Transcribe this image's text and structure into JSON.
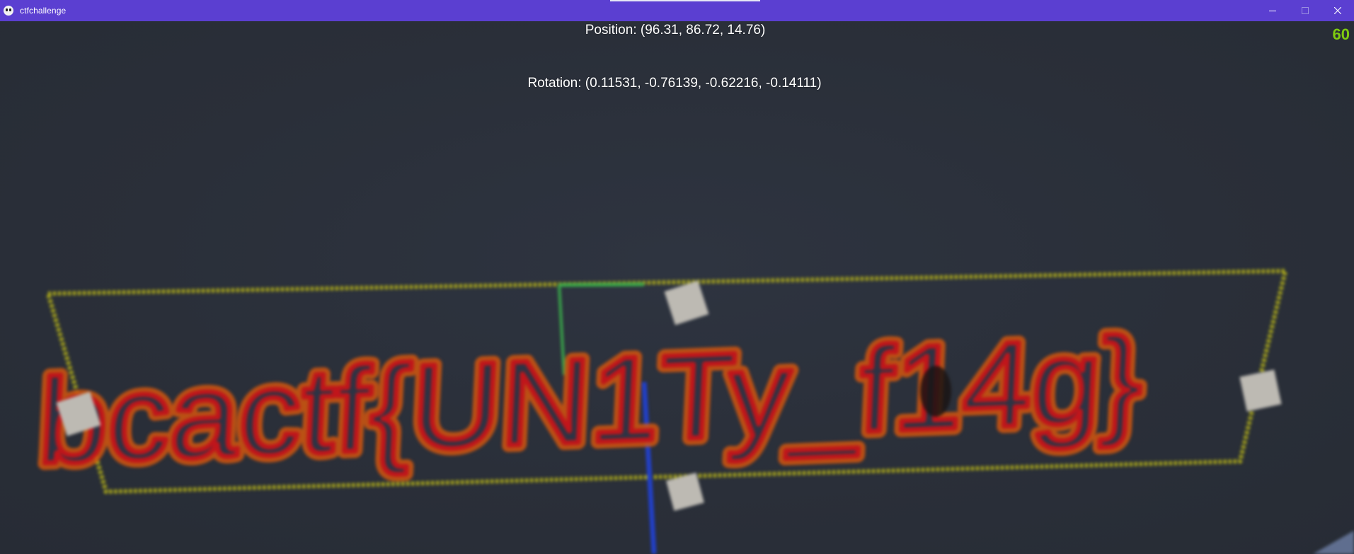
{
  "window": {
    "title": "ctfchallenge",
    "controls": [
      "minimize-icon",
      "maximize-icon",
      "close-icon"
    ]
  },
  "hud": {
    "position": "Position: (96.31, 86.72, 14.76)",
    "rotation": "Rotation: (0.11531, -0.76139, -0.62216, -0.14111)",
    "fps": "60"
  },
  "scene": {
    "flag_text": "bcactf{UN1Ty_f14g}",
    "colors": {
      "background": "#2a2f39",
      "titlebar": "#5b3fd1",
      "text_fill": "#c0151b",
      "text_glow": "#d4570f",
      "outline": "#c9c414",
      "handle": "#bdbab3",
      "axis_blue": "#2240c8",
      "axis_green": "#3aa84a",
      "fps": "#7ecb10"
    }
  }
}
